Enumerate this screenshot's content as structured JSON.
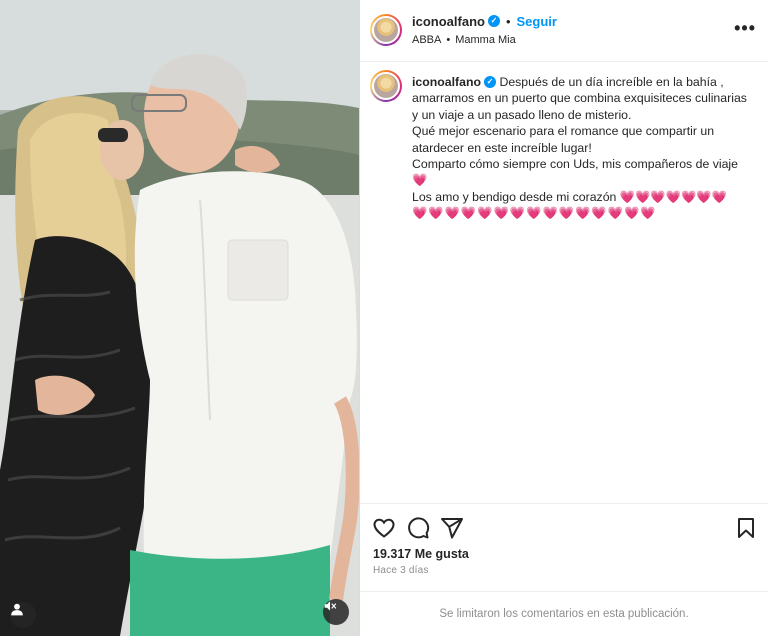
{
  "post": {
    "username": "iconoalfano",
    "follow_label": "Seguir",
    "separator": "•",
    "audio": {
      "artist": "ABBA",
      "separator": "•",
      "song": "Mamma Mia"
    },
    "more_icon": "more-options-icon",
    "verified_icon": "verified-badge-icon"
  },
  "caption": {
    "username": "iconoalfano",
    "lines": [
      "Después de un día increíble en la bahía ,",
      "amarramos en un puerto que combina exquisiteces culinarias",
      "y un viaje a un pasado lleno de misterio.",
      "Qué mejor escenario para el romance que compartir un",
      "atardecer en este increíble lugar!",
      "Comparto cómo siempre con Uds, mis compañeros de viaje",
      "💗",
      "Los amo y bendigo desde mi corazón 💗💗💗💗💗💗💗",
      "💗💗💗💗💗💗💗💗💗💗💗💗💗💗💗"
    ]
  },
  "actions": {
    "like_icon": "heart-icon",
    "comment_icon": "comment-icon",
    "share_icon": "send-icon",
    "save_icon": "bookmark-icon"
  },
  "likes_text": "19.317 Me gusta",
  "time_text": "Hace 3 días",
  "comments_disabled_text": "Se limitaron los comentarios en esta publicación.",
  "media": {
    "user_tag_icon": "user-tag-icon",
    "mute_icon": "muted-speaker-icon"
  },
  "colors": {
    "link_blue": "#0095f6",
    "verified": "#0095f6",
    "heart_pink": "#e83a8f",
    "muted_text": "#8e8e8e"
  }
}
